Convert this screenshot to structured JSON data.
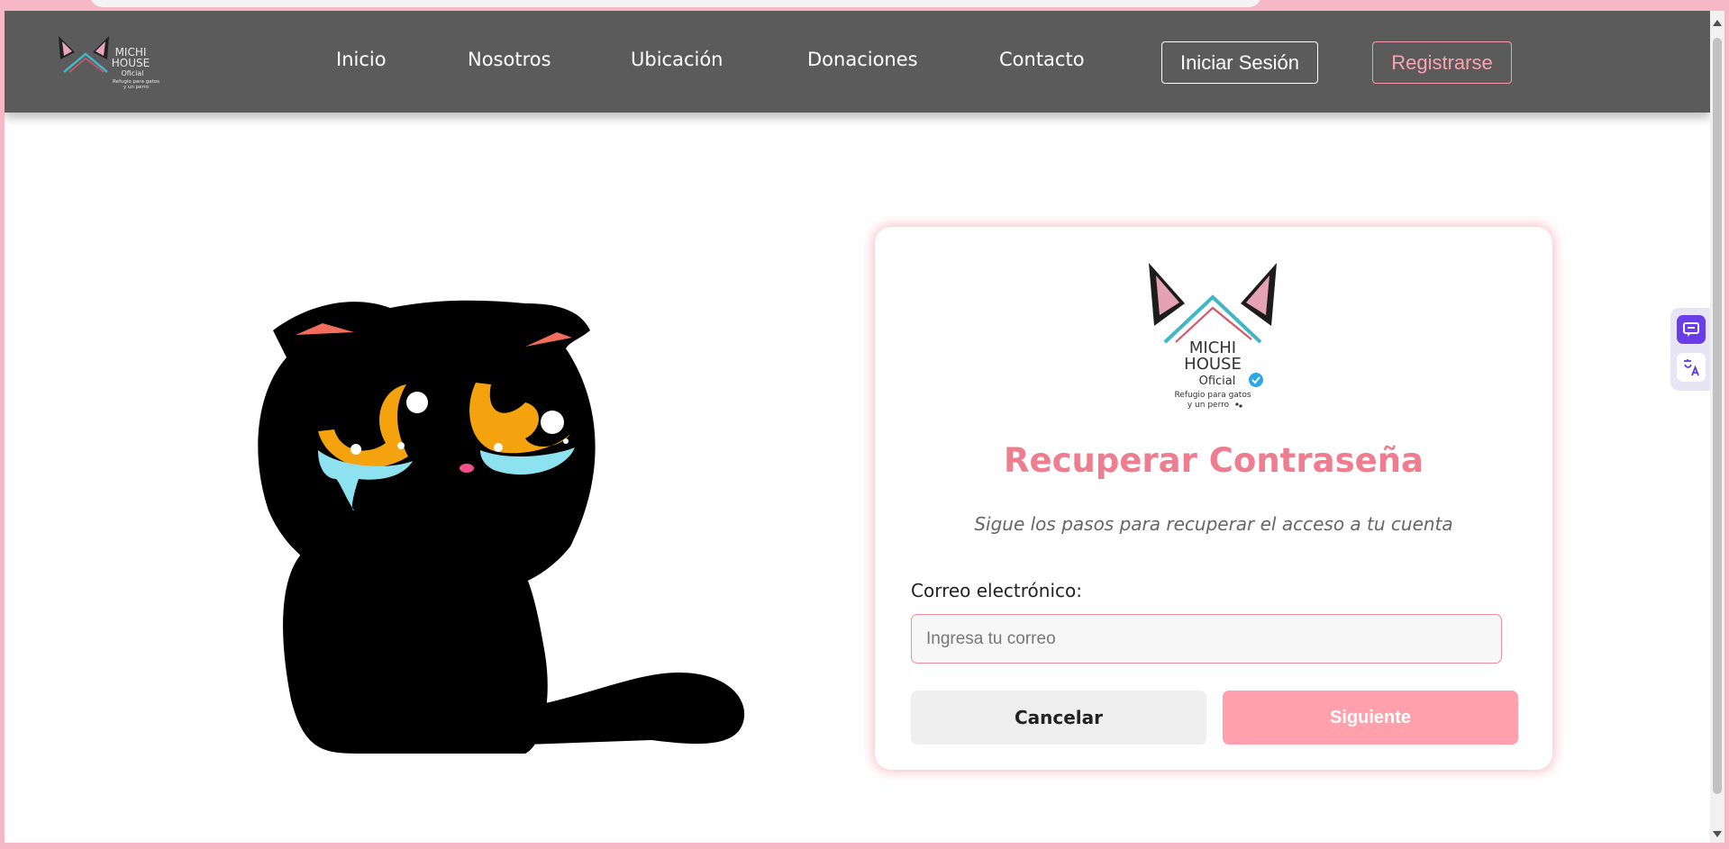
{
  "nav": {
    "logo": {
      "line1": "MICHI",
      "line2": "HOUSE",
      "line3": "Oficial",
      "tagline1": "Refugio para gatos",
      "tagline2": "y un perro"
    },
    "links": [
      "Inicio",
      "Nosotros",
      "Ubicación",
      "Donaciones",
      "Contacto"
    ],
    "login_label": "Iniciar Sesión",
    "register_label": "Registrarse"
  },
  "illustration": {
    "icon": "crying-black-cat"
  },
  "card": {
    "logo": {
      "line1": "MICHI",
      "line2": "HOUSE",
      "line3": "Oficial",
      "tagline1": "Refugio para gatos",
      "tagline2": "y un perro"
    },
    "title": "Recuperar Contraseña",
    "subtitle": "Sigue los pasos para recuperar el acceso a tu cuenta",
    "email_label": "Correo electrónico:",
    "email_placeholder": "Ingresa tu correo",
    "email_value": "",
    "cancel_label": "Cancelar",
    "next_label": "Siguiente"
  },
  "side_widget": {
    "icons": [
      "chat-icon",
      "translate-icon"
    ]
  },
  "colors": {
    "page_border": "#f6b8c6",
    "navbar": "#5b5b5b",
    "accent_pink": "#ee7d8f",
    "next_button": "#ffa0ac",
    "logo_teal": "#3fb7c5",
    "logo_red": "#d4576c"
  }
}
